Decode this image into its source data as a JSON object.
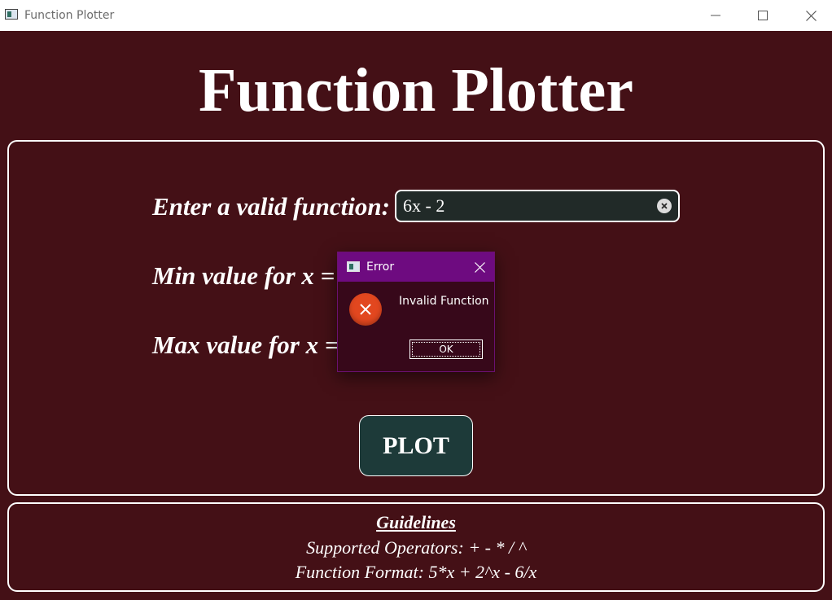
{
  "window": {
    "title": "Function Plotter"
  },
  "header": {
    "title": "Function Plotter"
  },
  "form": {
    "function_label": "Enter a valid function:",
    "function_value": "6x - 2",
    "min_label": "Min value for x =",
    "max_label": "Max value for x =",
    "plot_button": "PLOT"
  },
  "guidelines": {
    "title": "Guidelines",
    "operators": "Supported Operators: + - * / ^",
    "format": "Function Format: 5*x + 2^x - 6/x"
  },
  "dialog": {
    "title": "Error",
    "message": "Invalid Function",
    "ok_label": "OK"
  },
  "icons": {
    "app": "app-window-icon",
    "minimize": "minimize-icon",
    "maximize": "maximize-icon",
    "close": "close-icon",
    "clear": "clear-input-icon",
    "error": "error-icon"
  },
  "colors": {
    "background": "#441016",
    "input_bg": "#212a28",
    "button_bg": "#1d3a39",
    "dialog_bar": "#6e0b80",
    "dialog_bg": "#37081a",
    "error_red": "#e2471f"
  }
}
